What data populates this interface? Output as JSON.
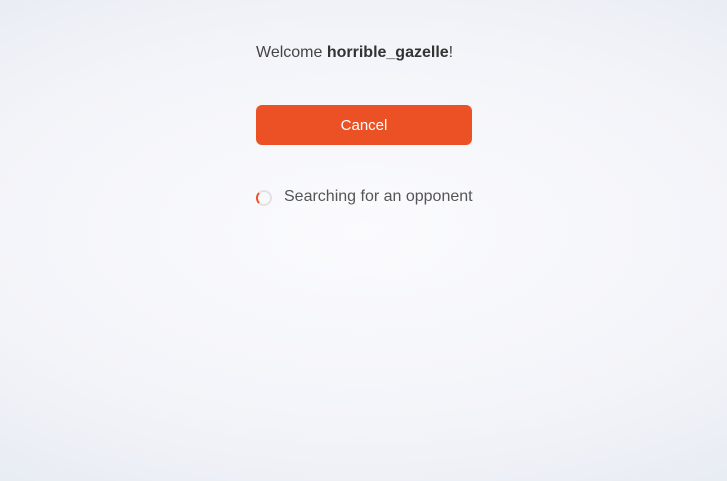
{
  "welcome": {
    "prefix": "Welcome ",
    "username": "horrible_gazelle",
    "suffix": "!"
  },
  "actions": {
    "cancel_label": "Cancel"
  },
  "status": {
    "text": "Searching for an opponent"
  },
  "colors": {
    "accent": "#ec5125",
    "text": "#444444"
  },
  "icons": {
    "status": "loading-spinner-icon"
  }
}
